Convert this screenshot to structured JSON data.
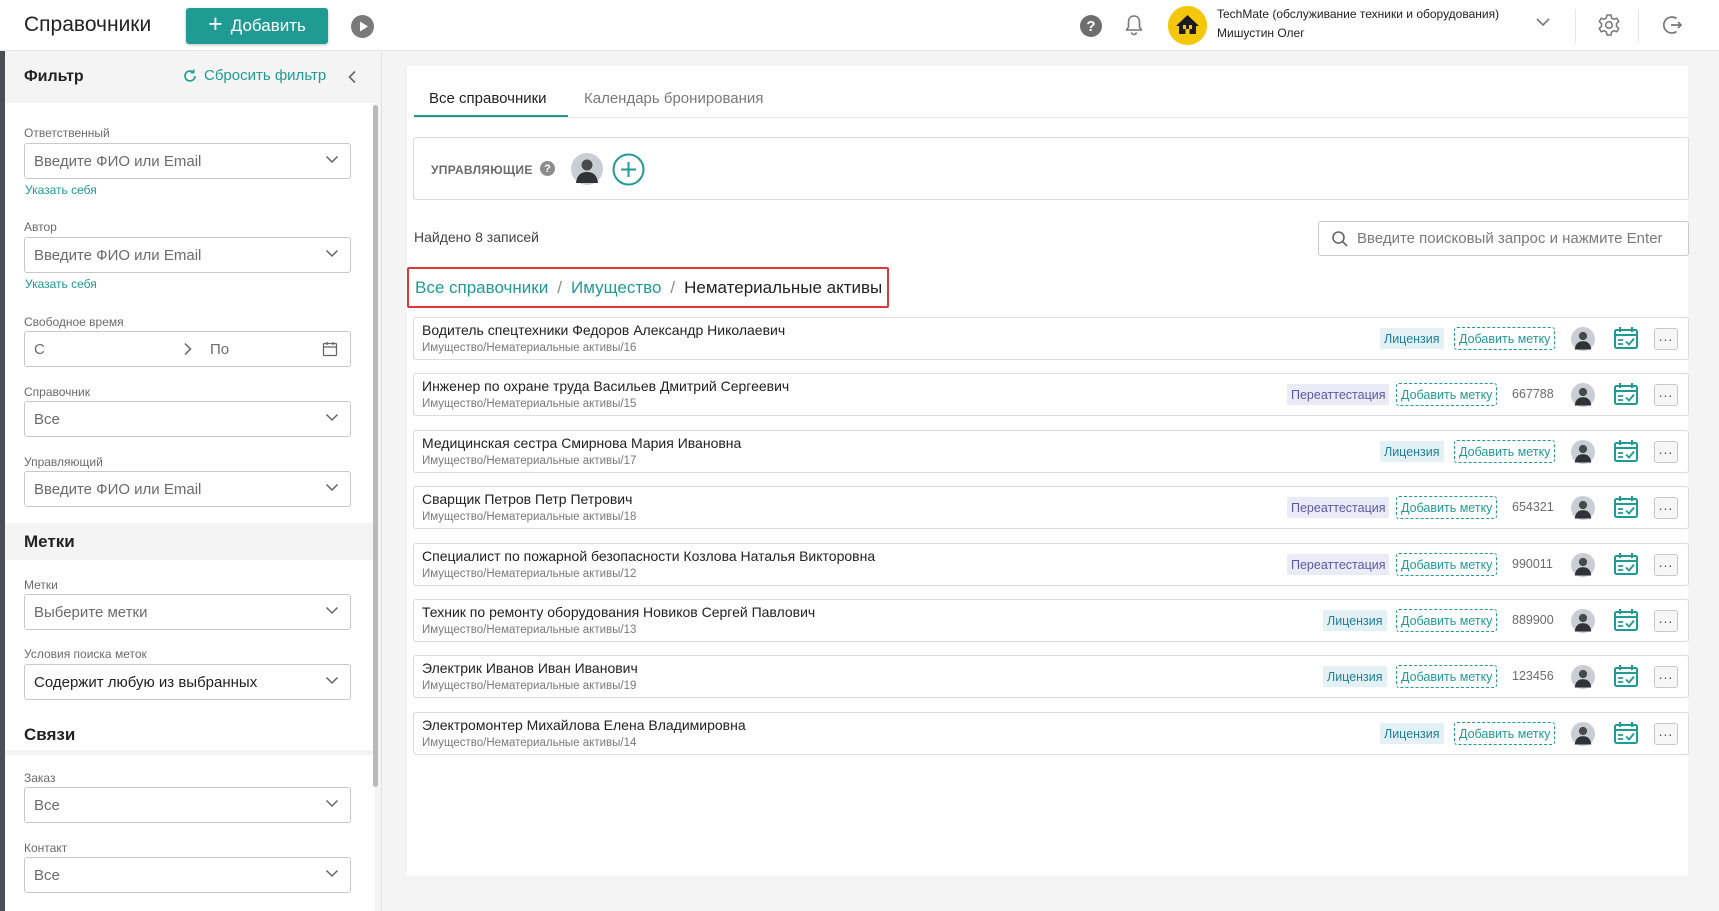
{
  "header": {
    "title": "Справочники",
    "add_label": "Добавить",
    "company_name": "TechMate (обслуживание техники и оборудования)",
    "user_name": "Мишустин Олег",
    "logo_text": "TechMate"
  },
  "sidebar": {
    "filter_title": "Фильтр",
    "reset_label": "Сбросить фильтр",
    "responsible": {
      "label": "Ответственный",
      "placeholder": "Введите ФИО или Email",
      "self_link": "Указать себя"
    },
    "author": {
      "label": "Автор",
      "placeholder": "Введите ФИО или Email",
      "self_link": "Указать себя"
    },
    "free_time": {
      "label": "Свободное время",
      "from": "С",
      "to": "По"
    },
    "directory": {
      "label": "Справочник",
      "value": "Все"
    },
    "manager": {
      "label": "Управляющий",
      "placeholder": "Введите ФИО или Email"
    },
    "tags_section": "Метки",
    "tags": {
      "label": "Метки",
      "placeholder": "Выберите метки"
    },
    "tag_condition": {
      "label": "Условия поиска меток",
      "value": "Содержит любую из выбранных"
    },
    "links_section": "Связи",
    "order": {
      "label": "Заказ",
      "value": "Все"
    },
    "contact": {
      "label": "Контакт",
      "value": "Все"
    }
  },
  "main": {
    "tabs": [
      {
        "label": "Все справочники",
        "active": true
      },
      {
        "label": "Календарь бронирования",
        "active": false
      }
    ],
    "managers_label": "УПРАВЛЯЮЩИЕ",
    "found_prefix": "Найдено",
    "found_count": "8",
    "found_suffix": "записей",
    "search_placeholder": "Введите поисковый запрос и нажмите Enter",
    "breadcrumb": [
      "Все справочники",
      "Имущество",
      "Нематериальные активы"
    ]
  },
  "rows": [
    {
      "title": "Водитель спецтехники Федоров Александр Николаевич",
      "path": "Имущество/Нематериальные активы/16",
      "badge": "Лицензия",
      "add_tag": "Добавить метку",
      "number": ""
    },
    {
      "title": "Инженер по охране труда Васильев Дмитрий Сергеевич",
      "path": "Имущество/Нематериальные активы/15",
      "badge": "Переаттестация",
      "add_tag": "Добавить метку",
      "number": "667788"
    },
    {
      "title": "Медицинская сестра Смирнова Мария Ивановна",
      "path": "Имущество/Нематериальные активы/17",
      "badge": "Лицензия",
      "add_tag": "Добавить метку",
      "number": ""
    },
    {
      "title": "Сварщик Петров Петр Петрович",
      "path": "Имущество/Нематериальные активы/18",
      "badge": "Переаттестация",
      "add_tag": "Добавить метку",
      "number": "654321"
    },
    {
      "title": "Специалист по пожарной безопасности Козлова Наталья Викторовна",
      "path": "Имущество/Нематериальные активы/12",
      "badge": "Переаттестация",
      "add_tag": "Добавить метку",
      "number": "990011"
    },
    {
      "title": "Техник по ремонту оборудования Новиков Сергей Павлович",
      "path": "Имущество/Нематериальные активы/13",
      "badge": "Лицензия",
      "add_tag": "Добавить метку",
      "number": "889900"
    },
    {
      "title": "Электрик Иванов Иван Иванович",
      "path": "Имущество/Нематериальные активы/19",
      "badge": "Лицензия",
      "add_tag": "Добавить метку",
      "number": "123456"
    },
    {
      "title": "Электромонтер Михайлова Елена Владимировна",
      "path": "Имущество/Нематериальные активы/14",
      "badge": "Лицензия",
      "add_tag": "Добавить метку",
      "number": ""
    }
  ],
  "colors": {
    "accent": "#1f9b94",
    "highlight": "#d83a3a",
    "license_bg": "#e3f1f7",
    "recert_bg": "#ebebf7"
  }
}
